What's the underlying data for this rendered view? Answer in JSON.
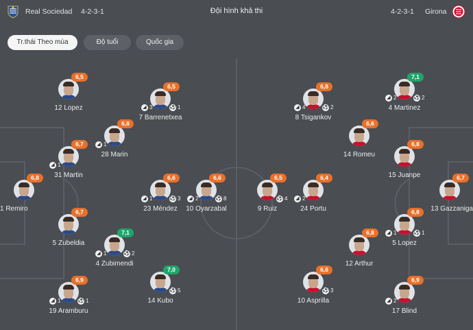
{
  "header": {
    "home_team": "Real Sociedad",
    "home_formation": "4-2-3-1",
    "title": "Đội hình khả thi",
    "away_formation": "4-2-3-1",
    "away_team": "Girona"
  },
  "tabs": [
    {
      "label": "Tr.thái Theo mùa",
      "active": true
    },
    {
      "label": "Độ tuổi",
      "active": false
    },
    {
      "label": "Quốc gia",
      "active": false
    }
  ],
  "colors": {
    "rating_orange": "#e8702a",
    "rating_green": "#1fa56a",
    "background": "#4a4d52"
  },
  "home_players": [
    {
      "name": "1 Remiro",
      "rating": "6,8",
      "tone": "orange",
      "boots": "",
      "balls": ""
    },
    {
      "name": "12 Lopez",
      "rating": "6,5",
      "tone": "orange",
      "boots": "",
      "balls": ""
    },
    {
      "name": "31 Martin",
      "rating": "6,7",
      "tone": "orange",
      "boots": "1",
      "balls": ""
    },
    {
      "name": "5 Zubeldia",
      "rating": "6,7",
      "tone": "orange",
      "boots": "",
      "balls": ""
    },
    {
      "name": "19 Aramburu",
      "rating": "6,9",
      "tone": "orange",
      "boots": "1",
      "balls": "1"
    },
    {
      "name": "28 Marin",
      "rating": "6,8",
      "tone": "orange",
      "boots": "1",
      "balls": ""
    },
    {
      "name": "4 Zubimendi",
      "rating": "7,1",
      "tone": "green",
      "boots": "1",
      "balls": "2"
    },
    {
      "name": "7 Barrenetxea",
      "rating": "6,5",
      "tone": "orange",
      "boots": "3",
      "balls": "1"
    },
    {
      "name": "23 Méndez",
      "rating": "6,6",
      "tone": "orange",
      "boots": "1",
      "balls": "3"
    },
    {
      "name": "14 Kubo",
      "rating": "7,0",
      "tone": "green",
      "boots": "",
      "balls": "5"
    },
    {
      "name": "10 Oyarzabal",
      "rating": "6,6",
      "tone": "orange",
      "boots": "2",
      "balls": "8"
    }
  ],
  "away_players": [
    {
      "name": "13 Gazzaniga",
      "rating": "6,7",
      "tone": "orange",
      "boots": "",
      "balls": ""
    },
    {
      "name": "4 Martinez",
      "rating": "7,1",
      "tone": "green",
      "boots": "2",
      "balls": "2"
    },
    {
      "name": "15 Juanpe",
      "rating": "6,8",
      "tone": "orange",
      "boots": "",
      "balls": ""
    },
    {
      "name": "5 Lopez",
      "rating": "6,8",
      "tone": "orange",
      "boots": "1",
      "balls": "1"
    },
    {
      "name": "17 Blind",
      "rating": "6,9",
      "tone": "orange",
      "boots": "2",
      "balls": ""
    },
    {
      "name": "14 Romeu",
      "rating": "6,6",
      "tone": "orange",
      "boots": "",
      "balls": ""
    },
    {
      "name": "12 Arthur",
      "rating": "6,8",
      "tone": "orange",
      "boots": "",
      "balls": ""
    },
    {
      "name": "8 Tsigankov",
      "rating": "6,8",
      "tone": "orange",
      "boots": "4",
      "balls": "2"
    },
    {
      "name": "24 Portu",
      "rating": "6,4",
      "tone": "orange",
      "boots": "2",
      "balls": ""
    },
    {
      "name": "10 Asprilla",
      "rating": "6,8",
      "tone": "orange",
      "boots": "",
      "balls": "3"
    },
    {
      "name": "9 Ruiz",
      "rating": "6,5",
      "tone": "orange",
      "boots": "",
      "balls": "4"
    }
  ]
}
